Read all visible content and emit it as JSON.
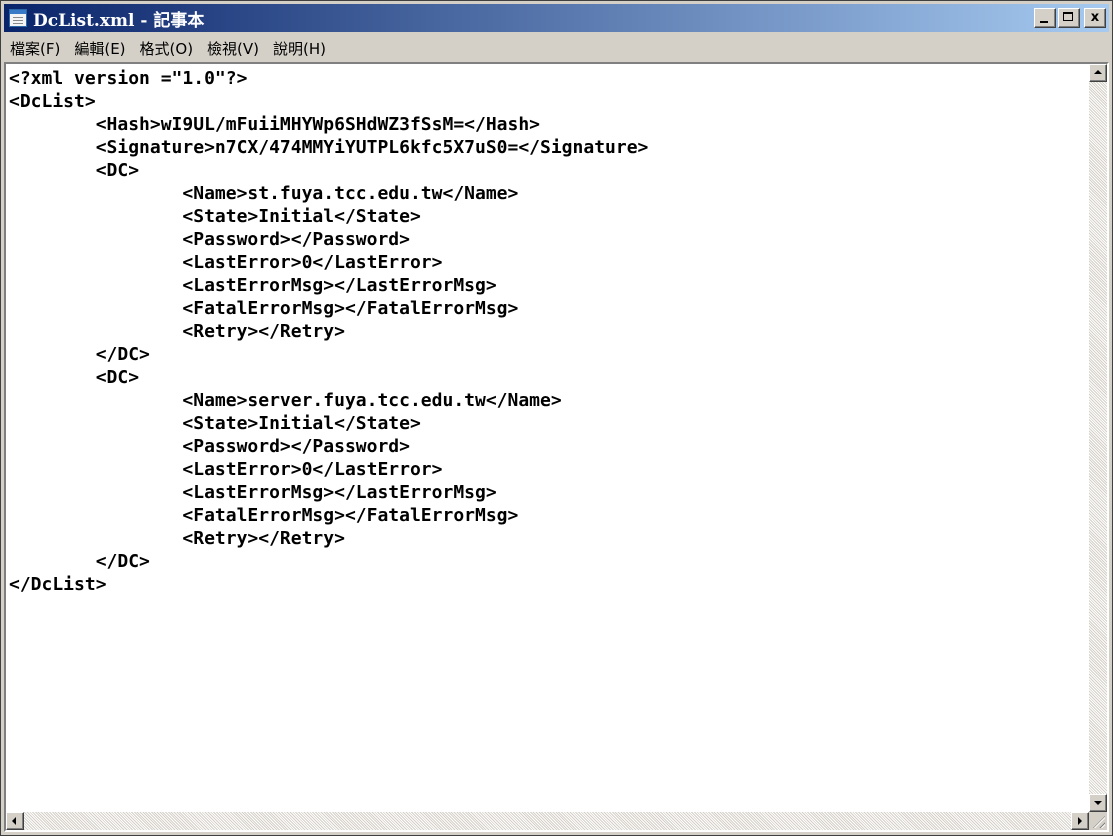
{
  "window": {
    "title": "DcList.xml - 記事本",
    "icon": "notepad-icon"
  },
  "caption_buttons": {
    "minimize": "minimize-icon",
    "maximize": "maximize-icon",
    "close_label": "x"
  },
  "menu": [
    {
      "label": "檔案(F)"
    },
    {
      "label": "編輯(E)"
    },
    {
      "label": "格式(O)"
    },
    {
      "label": "檢視(V)"
    },
    {
      "label": "說明(H)"
    }
  ],
  "document": {
    "lines": [
      "<?xml version =\"1.0\"?>",
      "<DcList>",
      "        <Hash>wI9UL/mFuiiMHYWp6SHdWZ3fSsM=</Hash>",
      "        <Signature>n7CX/474MMYiYUTPL6kfc5X7uS0=</Signature>",
      "        <DC>",
      "                <Name>st.fuya.tcc.edu.tw</Name>",
      "                <State>Initial</State>",
      "                <Password></Password>",
      "                <LastError>0</LastError>",
      "                <LastErrorMsg></LastErrorMsg>",
      "                <FatalErrorMsg></FatalErrorMsg>",
      "                <Retry></Retry>",
      "        </DC>",
      "        <DC>",
      "                <Name>server.fuya.tcc.edu.tw</Name>",
      "                <State>Initial</State>",
      "                <Password></Password>",
      "                <LastError>0</LastError>",
      "                <LastErrorMsg></LastErrorMsg>",
      "                <FatalErrorMsg></FatalErrorMsg>",
      "                <Retry></Retry>",
      "        </DC>",
      "</DcList>"
    ]
  }
}
